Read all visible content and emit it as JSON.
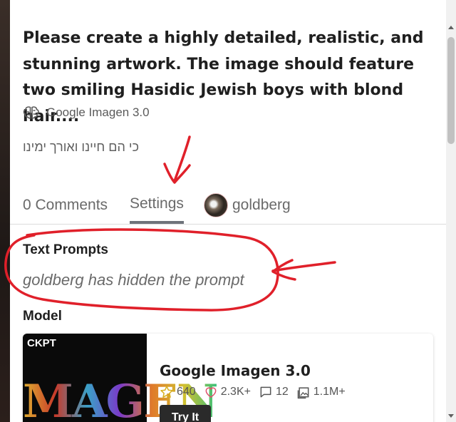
{
  "post": {
    "title": "Please create a highly detailed, realistic, and stunning artwork. The image should feature two smiling Hasidic Jewish boys with blond hair....",
    "model_tag": "Google Imagen 3.0",
    "model_tag_icon": "brain-icon",
    "hebrew_caption": "כי הם חיינו ואורך ימינו"
  },
  "tabs": {
    "comments_label": "0 Comments",
    "settings_label": "Settings",
    "user_label": "goldberg",
    "active": "Settings"
  },
  "settings": {
    "text_prompts_heading": "Text Prompts",
    "hidden_prompt_text": "goldberg has hidden the prompt",
    "model_heading": "Model"
  },
  "model_card": {
    "badge": "CKPT",
    "thumbnail_word": "MAGEN",
    "name": "Google Imagen 3.0",
    "stars": "640",
    "likes": "2.3K+",
    "comments": "12",
    "images": "1.1M+",
    "try_button": "Try It"
  },
  "colors": {
    "annotation_red": "#e0202a",
    "star_yellow": "#d8b020",
    "heart_red": "#e0506a",
    "button_dark": "#2a2a2a"
  }
}
